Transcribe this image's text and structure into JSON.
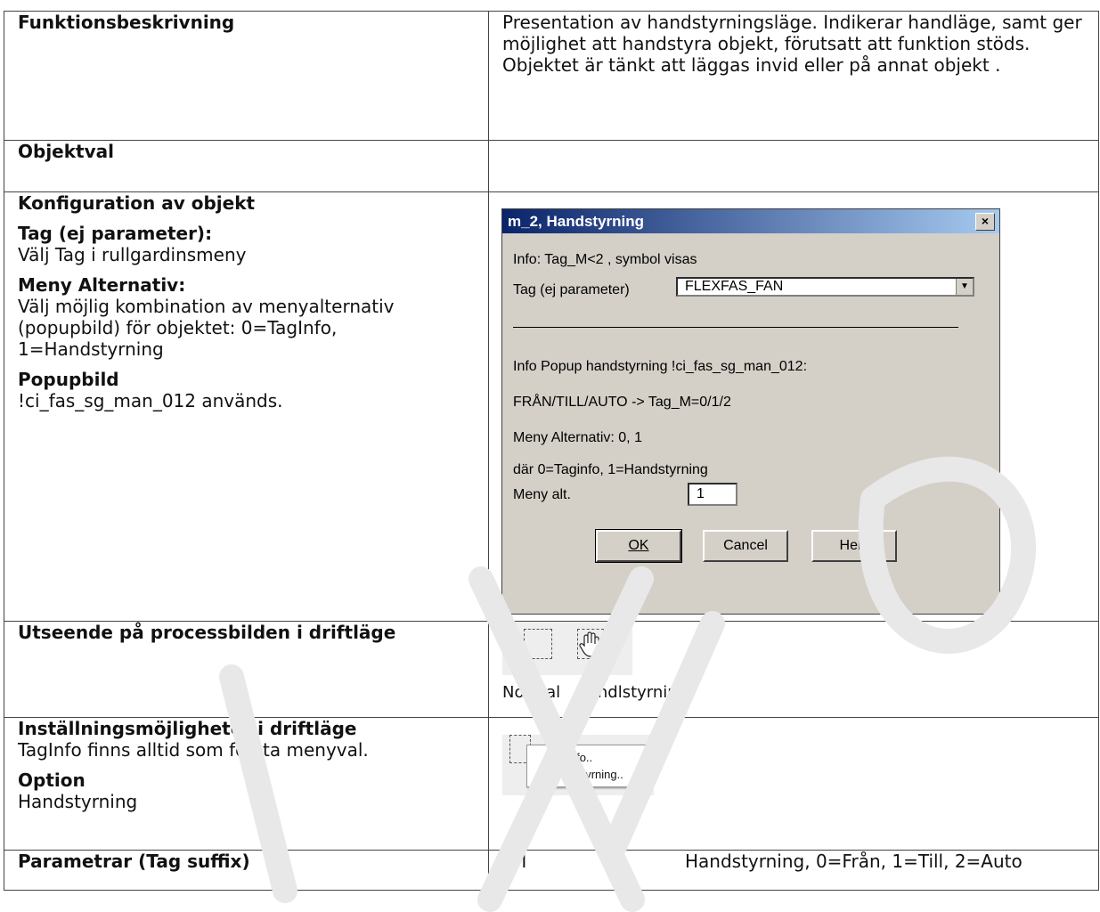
{
  "rows": {
    "functional_description": {
      "label": "Funktionsbeskrivning",
      "text": "Presentation av handstyrningsläge. Indikerar handläge, samt ger möjlighet att handstyra objekt, förutsatt att funktion stöds. Objektet är tänkt att läggas invid eller på annat objekt ."
    },
    "object_selection": {
      "label": "Objektval"
    },
    "configuration": {
      "label": "Konfiguration av objekt",
      "tag_heading": "Tag (ej parameter):",
      "tag_text": "Välj Tag i rullgardinsmeny",
      "menu_heading": "Meny Alternativ:",
      "menu_text": "Välj möjlig kombination av menyalternativ (popupbild) för objektet: 0=TagInfo, 1=Handstyrning",
      "popup_heading": "Popupbild",
      "popup_text": "!ci_fas_sg_man_012 används."
    },
    "appearance": {
      "label": "Utseende på processbilden i driftläge",
      "caption_normal": "Normal",
      "caption_hand": "Handlstyrning"
    },
    "settings": {
      "label": "Inställningsmöjligheter i driftläge",
      "text": "TagInfo finns alltid som första menyval.",
      "option_heading": "Option",
      "option_text": "Handstyrning",
      "menu_items": [
        "Taginfo..",
        "Handstyrning.."
      ]
    },
    "parameters": {
      "label": "Parametrar (Tag suffix)",
      "suffix": "_M",
      "description": "Handstyrning, 0=Från, 1=Till, 2=Auto"
    }
  },
  "dialog": {
    "title": "m_2, Handstyrning",
    "close_glyph": "×",
    "info_line": "Info: Tag_M<2 , symbol visas",
    "tag_label": "Tag (ej parameter)",
    "tag_value": "FLEXFAS_FAN",
    "popup_info": "Info Popup handstyrning !ci_fas_sg_man_012:",
    "mode_info": "FRÅN/TILL/AUTO -> Tag_M=0/1/2",
    "menu_info": "Meny Alternativ: 0, 1",
    "where_info": "där 0=Taginfo, 1=Handstyrning",
    "menu_alt_label": "Meny alt.",
    "menu_alt_value": "1",
    "ok_label": "OK",
    "cancel_label": "Cancel",
    "help_label": "Help"
  },
  "colors": {
    "border": "#444444",
    "dialog_face": "#d4d0c8",
    "titlebar": "#0a246a"
  }
}
